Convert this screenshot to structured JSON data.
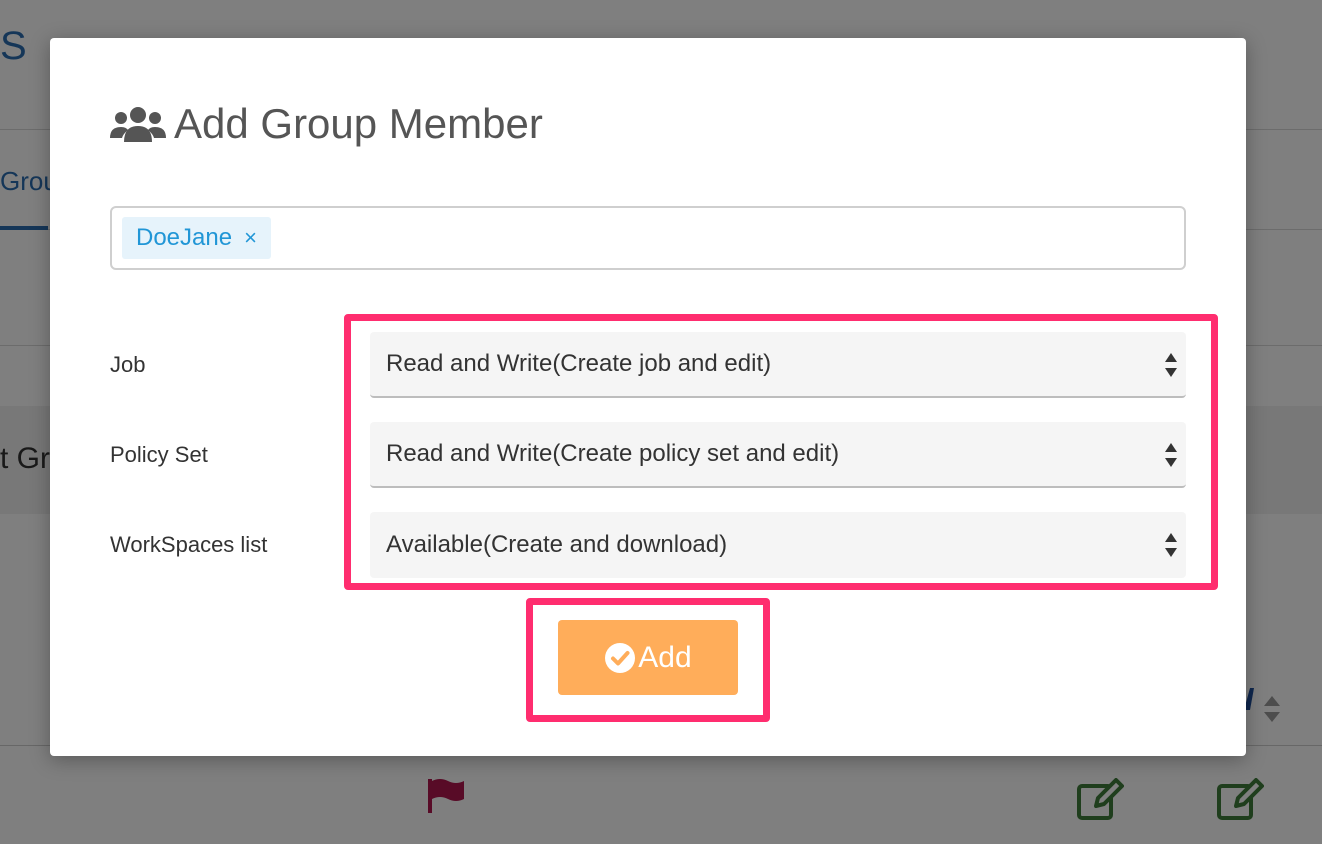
{
  "background": {
    "header_title": "S",
    "active_tab": "Grou",
    "section_title": "t Gr"
  },
  "modal": {
    "title": "Add Group Member",
    "title_icon": "users-icon",
    "selected_members": [
      {
        "label": "DoeJane",
        "remove_symbol": "×"
      }
    ],
    "fields": {
      "job": {
        "label": "Job",
        "value": "Read and Write(Create job and edit)"
      },
      "policy_set": {
        "label": "Policy Set",
        "value": "Read and Write(Create policy set and edit)"
      },
      "workspaces_list": {
        "label": "WorkSpaces list",
        "value": "Available(Create and download)"
      }
    },
    "add_button_label": "Add",
    "add_button_icon": "check-circle-icon"
  },
  "colors": {
    "accent_orange": "#ffad5a",
    "highlight": "#ff2d6f",
    "tag_blue": "#2196d6",
    "flag_red": "#b0174f",
    "edit_green": "#3f7d3a"
  }
}
